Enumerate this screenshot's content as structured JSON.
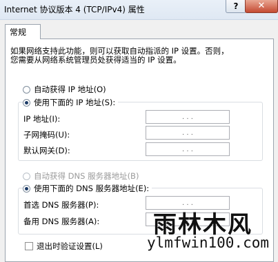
{
  "window": {
    "title": "Internet 协议版本 4 (TCP/IPv4) 属性",
    "help_label": "?",
    "close_label": "✕"
  },
  "tabs": [
    {
      "label": "常规",
      "selected": true
    }
  ],
  "description": "如果网络支持此功能，则可以获取自动指派的 IP 设置。否则，\n您需要从网络系统管理员处获得适当的 IP 设置。",
  "ip_section": {
    "auto_label": "自动获得 IP 地址(O)",
    "manual_label": "使用下面的 IP 地址(S):",
    "selected": "manual",
    "fields": [
      {
        "label": "IP 地址(I):",
        "value": ". . ."
      },
      {
        "label": "子网掩码(U):",
        "value": ". . ."
      },
      {
        "label": "默认网关(D):",
        "value": ". . ."
      }
    ]
  },
  "dns_section": {
    "auto_label": "自动获得 DNS 服务器地址(B)",
    "manual_label": "使用下面的 DNS 服务器地址(E):",
    "selected": "manual",
    "fields": [
      {
        "label": "首选 DNS 服务器(P):",
        "value": ". . ."
      },
      {
        "label": "备用 DNS 服务器(A):",
        "value": ". . ."
      }
    ]
  },
  "validate_on_exit": {
    "label": "退出时验证设置(L)",
    "checked": false
  },
  "watermark": {
    "name": "雨林木风",
    "url": "ylmfwin100.com"
  }
}
